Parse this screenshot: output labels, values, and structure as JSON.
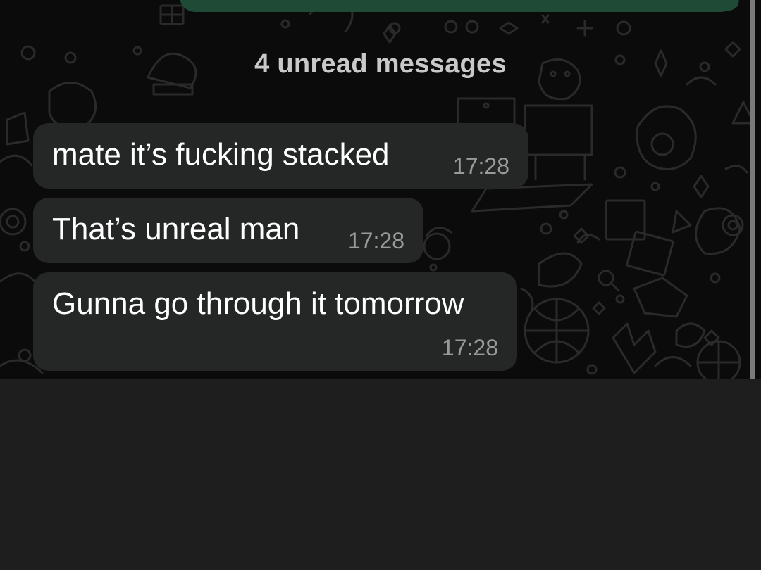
{
  "chat": {
    "unread_banner": "4 unread messages",
    "messages": [
      {
        "text": "mate it’s fucking stacked",
        "time": "17:28",
        "direction": "incoming"
      },
      {
        "text": "That’s unreal man",
        "time": "17:28",
        "direction": "incoming"
      },
      {
        "text": "Gunna go through it tomorrow",
        "time": "17:28",
        "direction": "incoming"
      }
    ]
  },
  "colors": {
    "chat_background": "#0b0b0b",
    "incoming_bubble": "#252626",
    "outgoing_bubble": "#1f4a36",
    "timestamp": "#9a9a9a",
    "panel_background": "#1e1e1e"
  }
}
